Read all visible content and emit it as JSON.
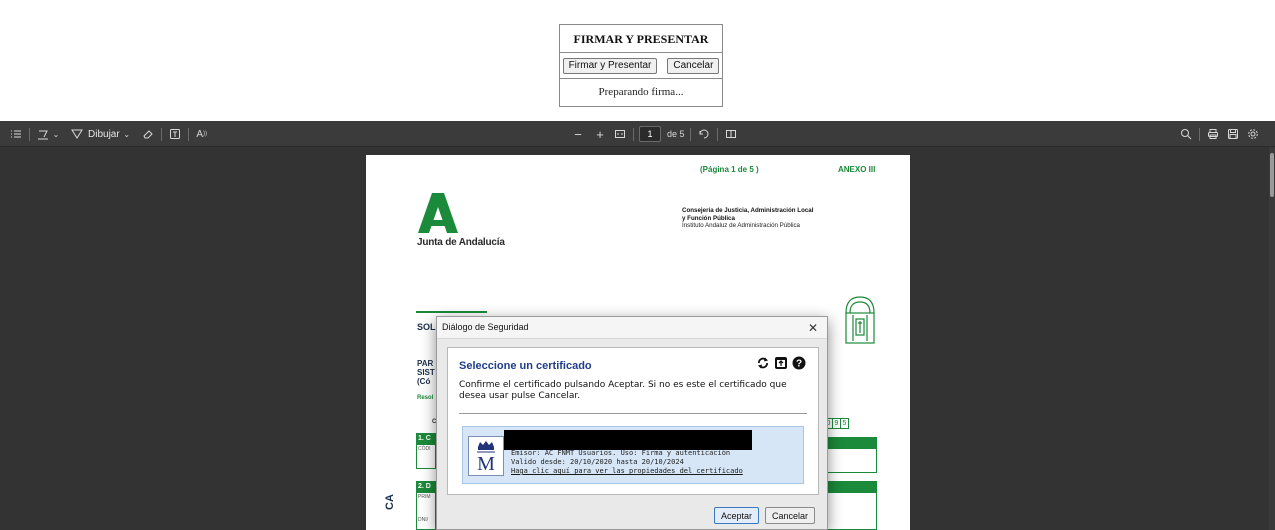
{
  "sign_panel": {
    "title": "FIRMAR Y PRESENTAR",
    "sign_button": "Firmar y Presentar",
    "cancel_button": "Cancelar",
    "status": "Preparando firma..."
  },
  "pdf_toolbar": {
    "draw_label": "Dibujar",
    "text_icon_label": "A",
    "zoom_out": "−",
    "zoom_in": "+",
    "page_number": "1",
    "page_total": "de 5"
  },
  "pdf_page": {
    "page_indicator": "(Página  1  de  5 )",
    "annex": "ANEXO III",
    "logo_text": "Junta de Andalucía",
    "ministry_line1": "Consejería de Justicia, Administración Local",
    "ministry_line2": "y Función Pública",
    "institute": "Instituto Andaluz de Administración Pública",
    "fragment_sol": "SOL",
    "fragment_par": "PAR",
    "fragment_sist": "SIST",
    "fragment_coc": "(Có",
    "fragment_resol": "Resol",
    "fragment_c": "C",
    "section1": "1. C",
    "section1_field": "CÓDI",
    "section2": "2. D",
    "section2_field1": "PRIM",
    "section2_field2": "DNI/",
    "digits": [
      "0",
      "9",
      "5"
    ],
    "side_letters": "CA"
  },
  "dialog": {
    "title": "Diálogo de Seguridad",
    "heading": "Seleccione un certificado",
    "description": "Confirme el certificado pulsando Aceptar. Si no es este el certificado que desea usar pulse Cancelar.",
    "cert_issuer": "Emisor: AC FNMT Usuarios. Uso: Firma y autenticación",
    "cert_validity": "Valido desde: 20/10/2020 hasta 20/10/2024",
    "cert_link": "Haga clic aquí para ver las propiedades del certificado",
    "accept_button": "Aceptar",
    "cancel_button": "Cancelar"
  },
  "colors": {
    "junta_green": "#1b8a3a",
    "viewer_dark": "#333333",
    "dialog_heading_blue": "#1f3f8c",
    "cert_selected_bg": "#d6e6f7"
  }
}
